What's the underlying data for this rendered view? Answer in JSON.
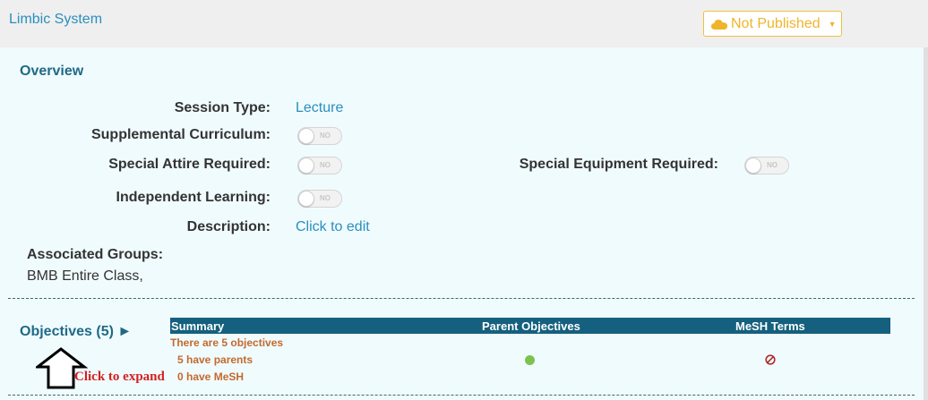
{
  "header": {
    "title": "Limbic System",
    "publish_status": "Not Published"
  },
  "overview": {
    "title": "Overview",
    "session_type_label": "Session Type:",
    "session_type_value": "Lecture",
    "supplemental_label": "Supplemental Curriculum:",
    "special_attire_label": "Special Attire Required:",
    "special_equipment_label": "Special Equipment Required:",
    "independent_label": "Independent Learning:",
    "description_label": "Description:",
    "description_value": "Click to edit",
    "toggle_text": "NO",
    "associated_groups_label": "Associated Groups:",
    "associated_groups_value": "BMB Entire Class,"
  },
  "objectives": {
    "title": "Objectives (5) ►",
    "columns": [
      "Summary",
      "Parent Objectives",
      "MeSH Terms"
    ],
    "summary_lines": [
      "There are 5 objectives",
      "5 have parents",
      "0 have MeSH"
    ],
    "annotation": "Click to expand",
    "status_colors": {
      "ok": "#7cc24e",
      "none": "#b02a2a"
    }
  }
}
